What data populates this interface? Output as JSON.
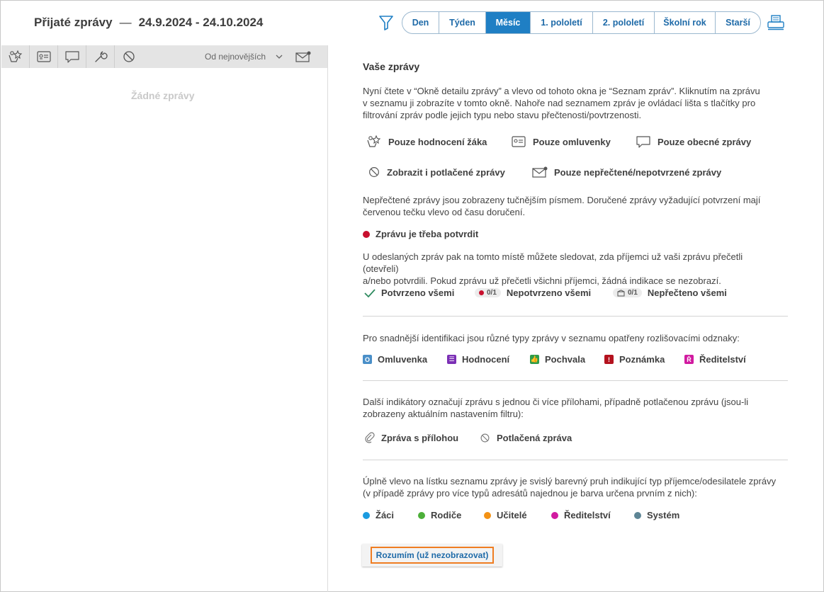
{
  "header": {
    "title": "Přijaté zprávy",
    "dash": "—",
    "date_range": "24.9.2024 - 24.10.2024"
  },
  "periods": [
    {
      "label": "Den"
    },
    {
      "label": "Týden"
    },
    {
      "label": "Měsíc",
      "active": true
    },
    {
      "label": "1. pololetí"
    },
    {
      "label": "2. pololetí"
    },
    {
      "label": "Školní rok"
    },
    {
      "label": "Starší"
    }
  ],
  "toolbar": {
    "buttons": [
      "student-rating-icon",
      "excuse-icon",
      "message-bubble-icon",
      "wrench-icon",
      "blocked-icon"
    ],
    "sort_label": "Od nejnovějších",
    "unread_icon": "envelope-dot-icon"
  },
  "list": {
    "empty": "Žádné zprávy"
  },
  "info": {
    "heading": "Vaše zprávy",
    "intro": [
      "Nyní čtete v “Okně detailu zprávy” a vlevo od tohoto okna je “Seznam zpráv”. Kliknutím na zprávu",
      "v seznamu ji zobrazíte v tomto okně. Nahoře nad seznamem zpráv je ovládací lišta s tlačítky pro",
      "filtrování zpráv podle jejich typu nebo stavu přečtenosti/povtrzenosti."
    ],
    "filters": {
      "rating": "Pouze hodnocení žáka",
      "excuses": "Pouze omluvenky",
      "general": "Pouze obecné zprávy",
      "suppressed": "Zobrazit i potlačené zprávy",
      "unread": "Pouze nepřečtené/nepotvrzené zprávy"
    },
    "unread_para": [
      "Nepřečtené zprávy jsou zobrazeny tučnějším písmem. Doručené zprávy vyžadující potvrzení mají",
      "červenou tečku vlevo od času doručení."
    ],
    "confirm_needed": "Zprávu je třeba potvrdit",
    "sent_para": [
      "U odeslaných zpráv pak na tomto místě můžete sledovat, zda příjemci už vaši zprávu přečetli (otevřeli)",
      "a/nebo potvrdili. Pokud zprávu už přečetli všichni příjemci, žádná indikace se nezobrazí."
    ],
    "status": {
      "confirmed_all": "Potvrzeno všemi",
      "counter": "0/1",
      "not_confirmed": "Nepotvrzeno všemi",
      "not_read": "Nepřečteno všemi"
    },
    "types_para": "Pro snadnější identifikaci jsou různé typy zprávy v seznamu opatřeny rozlišovacími odznaky:",
    "types": [
      {
        "label": "Omluvenka",
        "badge": "O",
        "color": "#4a8fc8"
      },
      {
        "label": "Hodnocení",
        "badge": "☰",
        "color": "#7b2fb5"
      },
      {
        "label": "Pochvala",
        "badge": "👍",
        "color": "#2e9d4a"
      },
      {
        "label": "Poznámka",
        "badge": "!",
        "color": "#b4121e"
      },
      {
        "label": "Ředitelství",
        "badge": "Ř",
        "color": "#d11aa0"
      }
    ],
    "attach_para": [
      "Další indikátory označují zprávu s jednou či více přílohami, případně potlačenou zprávu (jsou-li",
      "zobrazeny aktuálním nastavením filtru):"
    ],
    "attachment": "Zpráva s přílohou",
    "suppressed_msg": "Potlačená zpráva",
    "stripe_para": [
      "Úplně vlevo na lístku seznamu zprávy je svislý barevný pruh indikující typ příjemce/odesilatele zprávy",
      "(v případě zprávy pro více typů adresátů najednou je barva určena prvním z nich):"
    ],
    "recipients": [
      {
        "label": "Žáci",
        "color": "#1a9be0"
      },
      {
        "label": "Rodiče",
        "color": "#4caf39"
      },
      {
        "label": "Učitelé",
        "color": "#f39214"
      },
      {
        "label": "Ředitelství",
        "color": "#d11aa0"
      },
      {
        "label": "Systém",
        "color": "#5d8595"
      }
    ],
    "ok_button": "Rozumím (už nezobrazovat)"
  },
  "colors": {
    "accent": "#1f7fc4",
    "confirm_dot": "#c8102e",
    "highlight": "#ef7d22"
  }
}
